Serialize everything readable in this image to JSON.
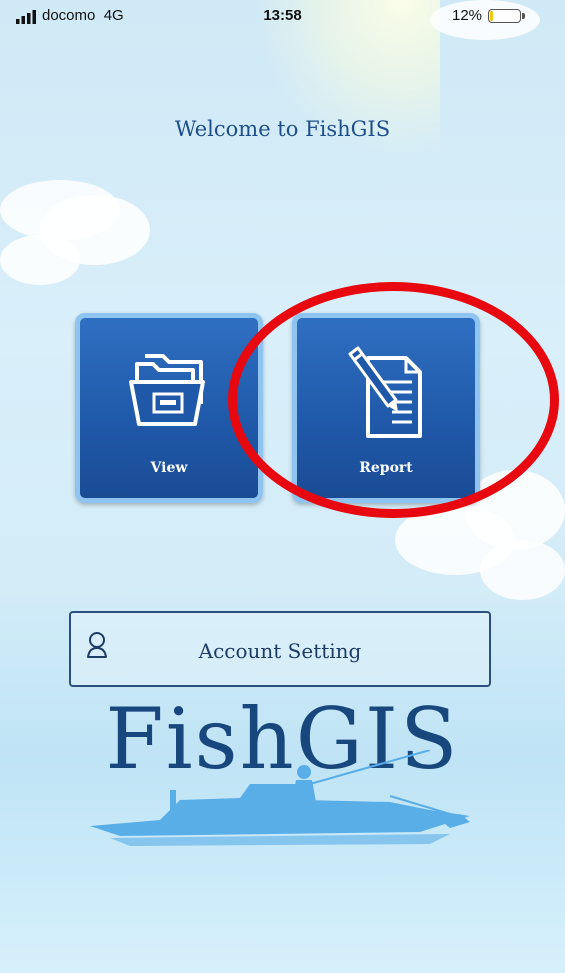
{
  "status_bar": {
    "carrier": "docomo",
    "network": "4G",
    "time": "13:58",
    "battery_percent": "12%",
    "battery_level": 0.12
  },
  "welcome_title": "Welcome to FishGIS",
  "tiles": [
    {
      "label": "View",
      "icon": "folder-icon"
    },
    {
      "label": "Report",
      "icon": "document-pencil-icon"
    }
  ],
  "account_button": {
    "label": "Account Setting",
    "icon": "user-icon"
  },
  "logo": "FishGIS",
  "colors": {
    "tile_blue": "#1f58a8",
    "tile_border": "#8fc3f0",
    "title_text": "#1e4f8a",
    "highlight_red": "#e8080f",
    "logo_text": "#18477e",
    "boat_silhouette": "#5aaee8"
  }
}
